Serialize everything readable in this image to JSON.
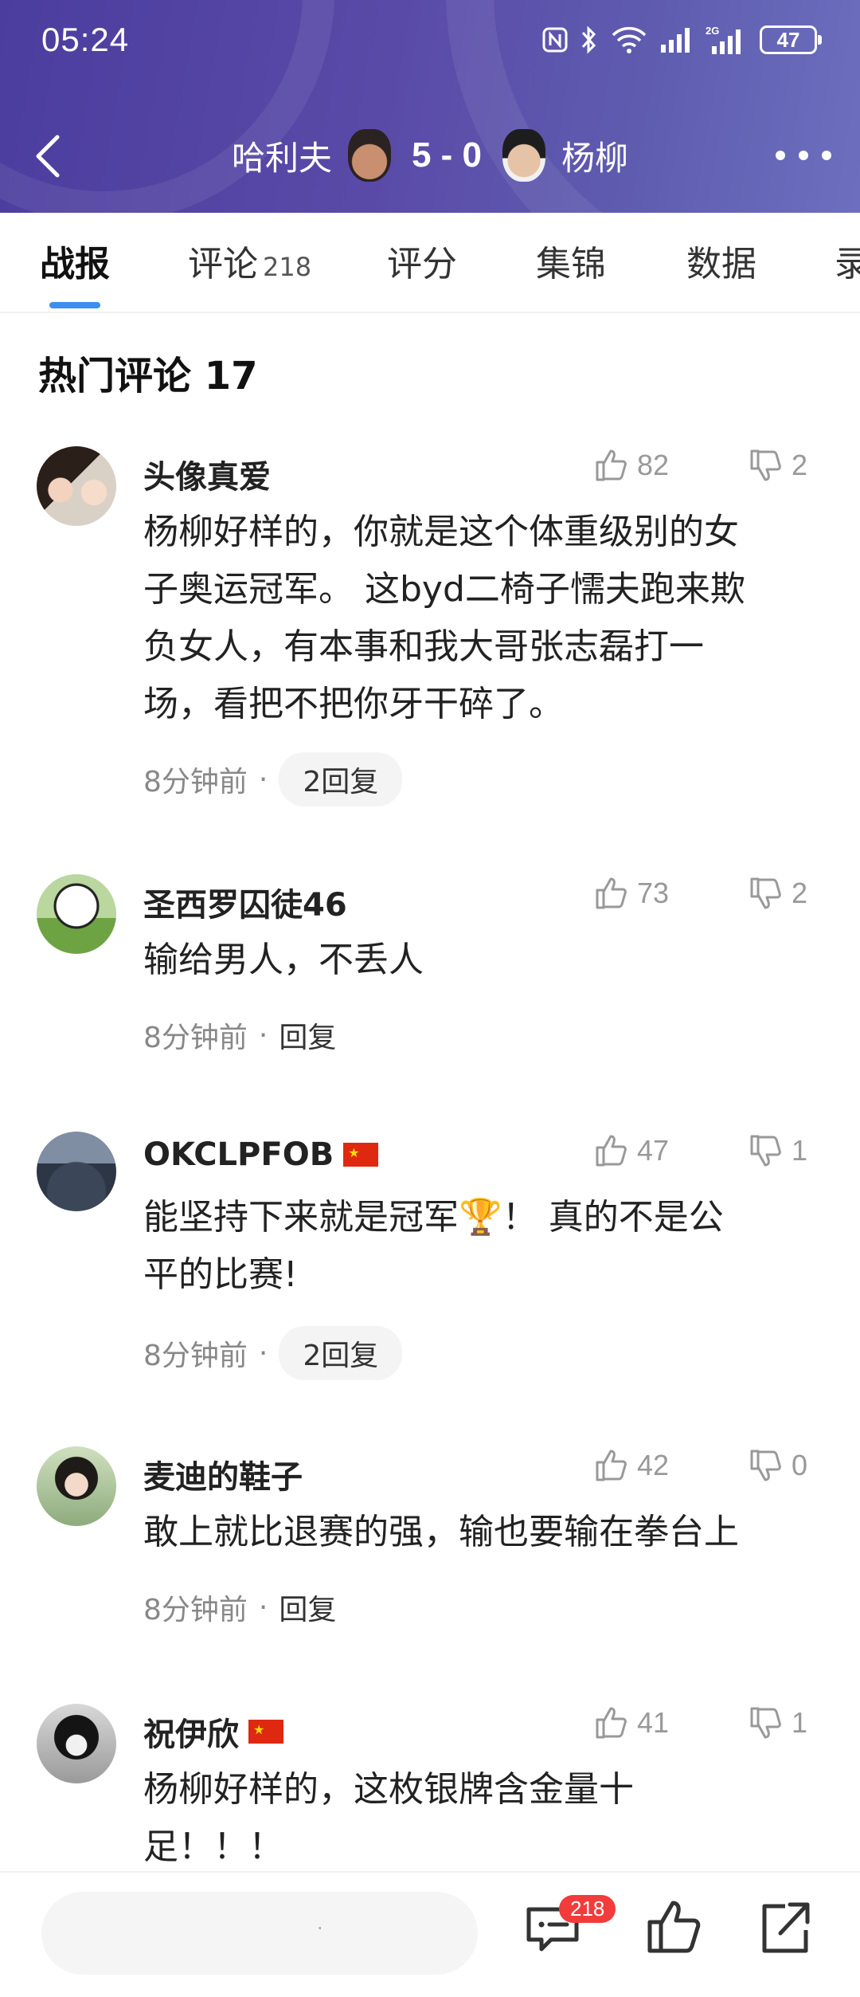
{
  "status_bar": {
    "time": "05:24",
    "battery": "47"
  },
  "header": {
    "player_left": "哈利夫",
    "score": "5 - 0",
    "player_right": "杨柳"
  },
  "tabs": [
    {
      "label": "战报",
      "active": true
    },
    {
      "label": "评论",
      "count": "218"
    },
    {
      "label": "评分"
    },
    {
      "label": "集锦"
    },
    {
      "label": "数据"
    },
    {
      "label": "录"
    }
  ],
  "section": {
    "title": "热门评论 17"
  },
  "comments": [
    {
      "user": "头像真爱",
      "likes": "82",
      "dislikes": "2",
      "lines": [
        "杨柳好样的，你就是这个体重级别的女",
        "子奥运冠军。 这byd二椅子懦夫跑来欺",
        "负女人，有本事和我大哥张志磊打一",
        "场，看把不把你牙干碎了。"
      ],
      "time": "8分钟前",
      "reply": "2回复"
    },
    {
      "user": "圣西罗囚徒46",
      "likes": "73",
      "dislikes": "2",
      "lines": [
        "输给男人，不丢人"
      ],
      "time": "8分钟前",
      "reply": "回复"
    },
    {
      "user": "OKCLPFOB",
      "likes": "47",
      "dislikes": "1",
      "lines": [
        "能坚持下来就是冠军🏆！ 真的不是公",
        "平的比赛!"
      ],
      "time": "8分钟前",
      "reply": "2回复"
    },
    {
      "user": "麦迪的鞋子",
      "likes": "42",
      "dislikes": "0",
      "lines": [
        "敢上就比退赛的强，输也要输在拳台上"
      ],
      "time": "8分钟前",
      "reply": "回复"
    },
    {
      "user": "祝伊欣",
      "likes": "41",
      "dislikes": "1",
      "lines": [
        "杨柳好样的，这枚银牌含金量十",
        "足！！！"
      ]
    }
  ],
  "bottom_bar": {
    "input_placeholder": "·",
    "comment_count": "218"
  },
  "colors": {
    "header_bg": "#4b3d9e",
    "tab_accent": "#3d8ef0",
    "badge": "#f23b3b"
  }
}
